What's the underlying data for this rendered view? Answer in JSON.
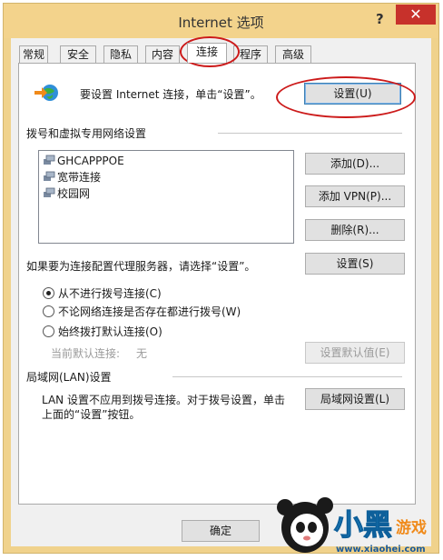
{
  "window": {
    "title": "Internet 选项",
    "help_glyph": "?",
    "close_glyph": "✕"
  },
  "tabs": [
    {
      "label": "常规"
    },
    {
      "label": "安全"
    },
    {
      "label": "隐私"
    },
    {
      "label": "内容"
    },
    {
      "label": "连接",
      "active": true
    },
    {
      "label": "程序"
    },
    {
      "label": "高级"
    }
  ],
  "setup": {
    "text": "要设置 Internet 连接，单击“设置”。",
    "button": "设置(U)",
    "icon": "internet-setup-icon"
  },
  "dialup": {
    "heading": "拨号和虚拟专用网络设置",
    "items": [
      "GHCAPPPOE",
      "宽带连接",
      "校园网"
    ],
    "add_button": "添加(D)...",
    "add_vpn_button": "添加 VPN(P)...",
    "delete_button": "删除(R)...",
    "proxy_text": "如果要为连接配置代理服务器，请选择“设置”。",
    "settings_button": "设置(S)",
    "options": [
      {
        "label": "从不进行拨号连接(C)",
        "selected": true
      },
      {
        "label": "不论网络连接是否存在都进行拨号(W)",
        "selected": false
      },
      {
        "label": "始终拨打默认连接(O)",
        "selected": false
      }
    ],
    "current_default_label": "当前默认连接:",
    "current_default_value": "无",
    "set_default_button": "设置默认值(E)"
  },
  "lan": {
    "heading": "局域网(LAN)设置",
    "text_line1": "LAN 设置不应用到拨号连接。对于拨号设置，单击",
    "text_line2": "上面的“设置”按钮。",
    "button": "局域网设置(L)"
  },
  "footer": {
    "ok_button": "确定"
  },
  "watermark": {
    "brand": "小黑游戏",
    "url": "www.xiaohei.com"
  },
  "colors": {
    "titlebar": "#f3d38c",
    "close": "#c7312b",
    "highlight_oval": "#cc1a1a"
  }
}
